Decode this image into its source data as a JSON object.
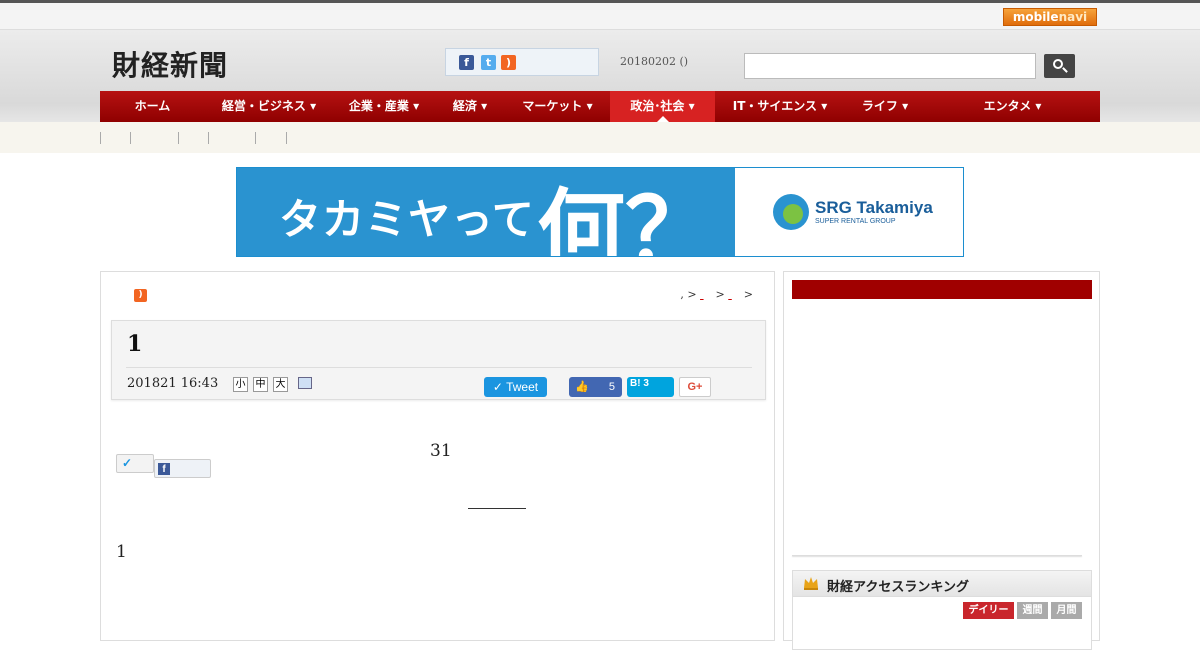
{
  "topbar": {
    "mobilenavi_label_a": "mobile",
    "mobilenavi_label_b": "navi"
  },
  "header": {
    "logo": "財経新聞",
    "date": "20180202 ()",
    "search": {
      "placeholder": ""
    }
  },
  "nav": {
    "items": [
      {
        "label": "ホーム"
      },
      {
        "label": "経営・ビジネス ▾"
      },
      {
        "label": "企業・産業 ▾"
      },
      {
        "label": "経済 ▾"
      },
      {
        "label": "マーケット ▾"
      },
      {
        "label": "政治･社会 ▾"
      },
      {
        "label": "IT・サイエンス ▾"
      },
      {
        "label": "ライフ ▾"
      },
      {
        "label": "エンタメ ▾"
      }
    ],
    "active_index": 5
  },
  "banner": {
    "text": "タカミヤって",
    "big_text": "何？",
    "brand": "SRG Takamiya",
    "brand_sub": "SUPER RENTAL GROUP"
  },
  "article": {
    "breadcrumb": {
      "prefix": ", > ",
      "mid": " > ",
      "suffix": " >"
    },
    "title": "1",
    "date": "201821 16:43",
    "font_sizes": [
      "小",
      "中",
      "大"
    ],
    "tweet_label": "Tweet",
    "like_count": "5",
    "hatena_label": "B!",
    "hatena_count": "3",
    "gplus_label": "G+",
    "body_number": "31",
    "body_text": "1"
  },
  "sidebar": {
    "ranking": {
      "title": "財経アクセスランキング",
      "tabs": [
        "デイリー",
        "週間",
        "月間"
      ]
    }
  },
  "colors": {
    "nav_red": "#a00000",
    "nav_active": "#d72222",
    "banner_blue": "#2a93d0",
    "facebook": "#3b5998",
    "twitter": "#1b95e0",
    "hatena": "#00a4de"
  }
}
